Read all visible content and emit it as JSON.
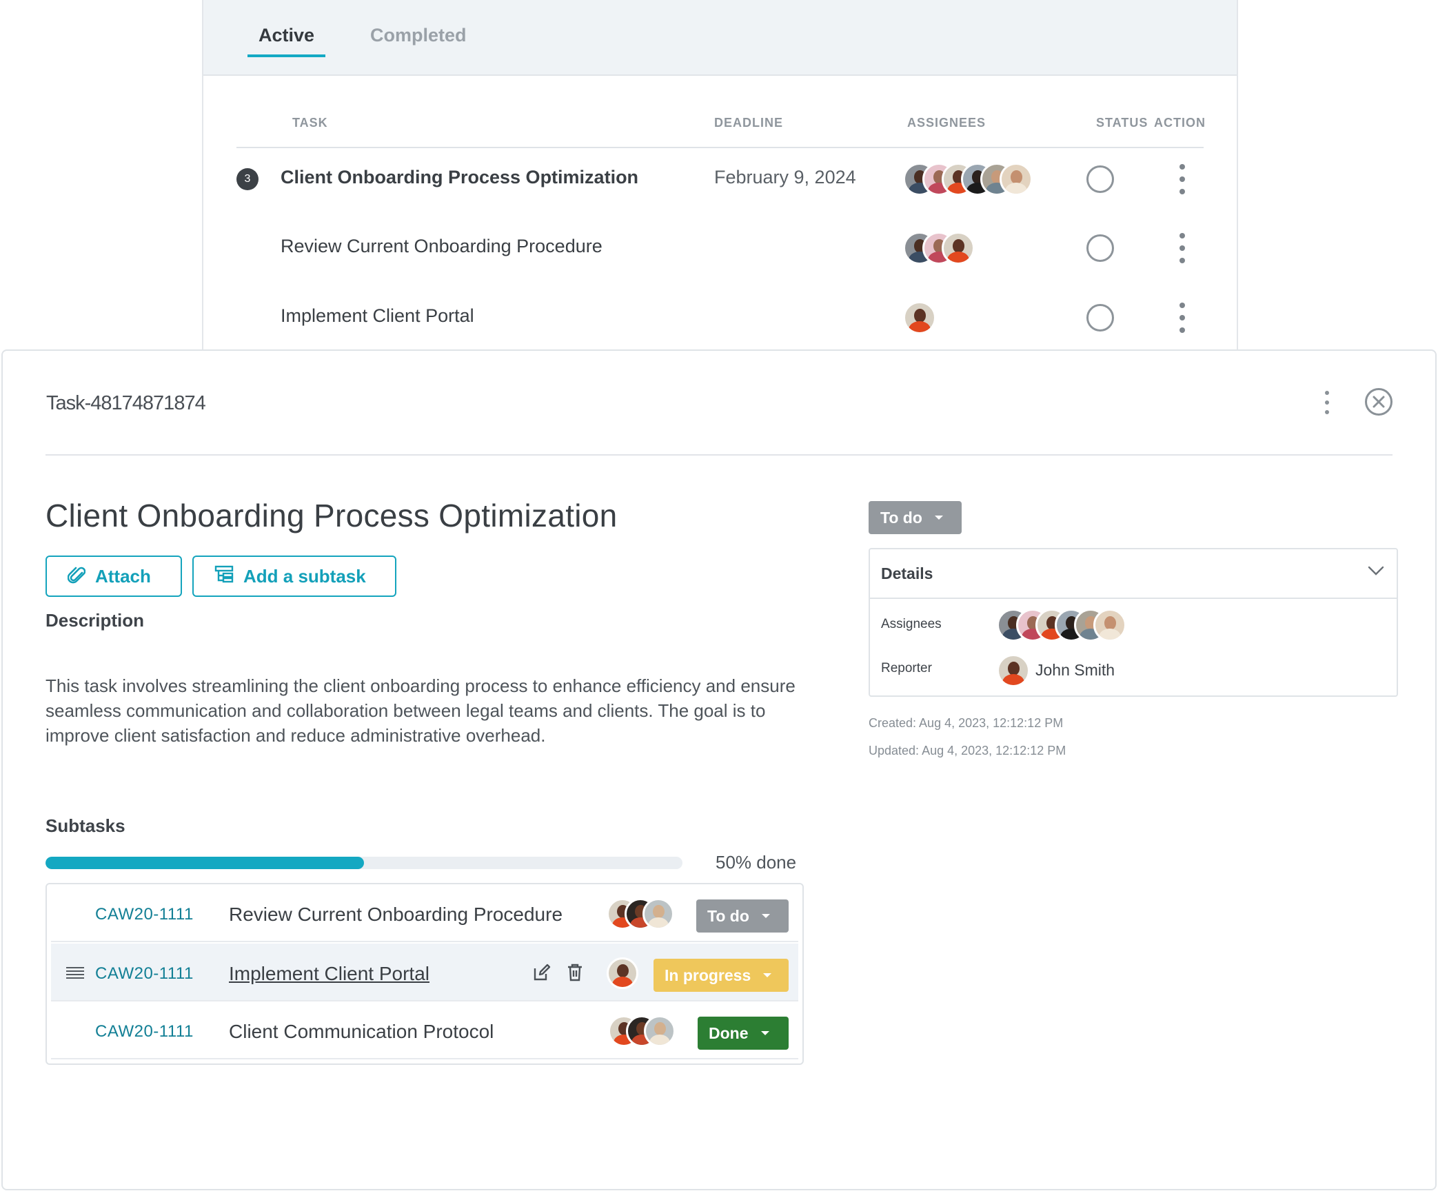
{
  "list": {
    "tabs": [
      {
        "label": "Active",
        "active": true
      },
      {
        "label": "Completed",
        "active": false
      }
    ],
    "columns": {
      "task": "TASK",
      "deadline": "DEADLINE",
      "assignees": "ASSIGNEES",
      "status": "STATUS",
      "action": "ACTION"
    },
    "rows": [
      {
        "count": "3",
        "title": "Client Onboarding Process Optimization",
        "deadline": "February 9, 2024"
      },
      {
        "title": "Review Current Onboarding Procedure",
        "deadline": ""
      },
      {
        "title": "Implement Client Portal",
        "deadline": ""
      }
    ]
  },
  "panel": {
    "task_id": "Task-48174871874",
    "title": "Client Onboarding Process Optimization",
    "attach_label": "Attach",
    "add_subtask_label": "Add a subtask",
    "description_label": "Description",
    "description": "This task involves streamlining the client onboarding process to enhance efficiency and ensure seamless communication and collaboration between legal teams and clients. The goal is to improve client satisfaction and reduce administrative overhead.",
    "subtasks_label": "Subtasks",
    "progress": {
      "fraction": 0.5,
      "label": "50% done"
    },
    "subtasks": [
      {
        "code": "CAW20-1111",
        "title": "Review Current Onboarding Procedure",
        "status": "To do"
      },
      {
        "code": "CAW20-1111",
        "title": "Implement Client Portal",
        "status": "In progress"
      },
      {
        "code": "CAW20-1111",
        "title": "Client Communication Protocol",
        "status": "Done"
      }
    ],
    "status": "To do",
    "details": {
      "label": "Details",
      "assignees_label": "Assignees",
      "reporter_label": "Reporter",
      "reporter_name": "John Smith"
    },
    "created": "Created: Aug 4, 2023, 12:12:12 PM",
    "updated": "Updated: Aug 4, 2023, 12:12:12 PM"
  },
  "colors": {
    "accent": "#14a8c2",
    "status_todo": "#94999e",
    "status_in_progress": "#efc75b",
    "status_done": "#2c7e33"
  },
  "icons": [
    "kebab-icon",
    "close-icon",
    "paperclip-icon",
    "subtask-icon",
    "chevron-down-icon",
    "drag-handle-icon",
    "edit-icon",
    "trash-icon",
    "status-circle-icon"
  ]
}
